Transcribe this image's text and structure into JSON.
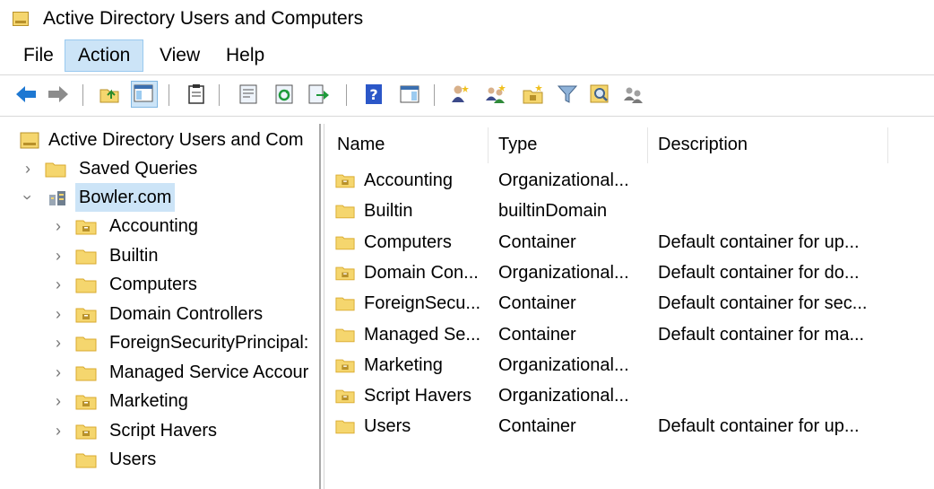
{
  "window": {
    "title": "Active Directory Users and Computers"
  },
  "menu": [
    "File",
    "Action",
    "View",
    "Help"
  ],
  "toolbar": [
    {
      "icon": "back-arrow-icon"
    },
    {
      "icon": "forward-arrow-icon"
    },
    {
      "icon": "up-folder-icon"
    },
    {
      "icon": "show-hide-console-tree-icon"
    },
    {
      "icon": "clipboard-icon"
    },
    {
      "icon": "properties-icon"
    },
    {
      "icon": "refresh-icon"
    },
    {
      "icon": "export-list-icon"
    },
    {
      "icon": "help-icon"
    },
    {
      "icon": "action-pane-icon"
    },
    {
      "icon": "new-user-icon"
    },
    {
      "icon": "new-group-icon"
    },
    {
      "icon": "new-ou-icon"
    },
    {
      "icon": "filter-icon"
    },
    {
      "icon": "find-icon"
    },
    {
      "icon": "add-to-group-icon"
    }
  ],
  "tree": {
    "root": "Active Directory Users and Com",
    "saved_queries": "Saved Queries",
    "domain": "Bowler.com",
    "children": [
      {
        "label": "Accounting",
        "kind": "ou",
        "expandable": true
      },
      {
        "label": "Builtin",
        "kind": "folder",
        "expandable": true
      },
      {
        "label": "Computers",
        "kind": "folder",
        "expandable": true
      },
      {
        "label": "Domain Controllers",
        "kind": "ou",
        "expandable": true
      },
      {
        "label": "ForeignSecurityPrincipal:",
        "kind": "folder",
        "expandable": true
      },
      {
        "label": "Managed Service Accour",
        "kind": "folder",
        "expandable": true
      },
      {
        "label": "Marketing",
        "kind": "ou",
        "expandable": true
      },
      {
        "label": "Script Havers",
        "kind": "ou",
        "expandable": true
      },
      {
        "label": "Users",
        "kind": "folder",
        "expandable": false
      }
    ]
  },
  "list": {
    "columns": [
      "Name",
      "Type",
      "Description"
    ],
    "rows": [
      {
        "name": "Accounting",
        "type": "Organizational...",
        "description": "",
        "kind": "ou"
      },
      {
        "name": "Builtin",
        "type": "builtinDomain",
        "description": "",
        "kind": "folder"
      },
      {
        "name": "Computers",
        "type": "Container",
        "description": "Default container for up...",
        "kind": "folder"
      },
      {
        "name": "Domain Con...",
        "type": "Organizational...",
        "description": "Default container for do...",
        "kind": "ou"
      },
      {
        "name": "ForeignSecu...",
        "type": "Container",
        "description": "Default container for sec...",
        "kind": "folder"
      },
      {
        "name": "Managed Se...",
        "type": "Container",
        "description": "Default container for ma...",
        "kind": "folder"
      },
      {
        "name": "Marketing",
        "type": "Organizational...",
        "description": "",
        "kind": "ou"
      },
      {
        "name": "Script Havers",
        "type": "Organizational...",
        "description": "",
        "kind": "ou"
      },
      {
        "name": "Users",
        "type": "Container",
        "description": "Default container for up...",
        "kind": "folder"
      }
    ]
  },
  "colors": {
    "selection": "#cce4f7",
    "folder": "#f5d66e",
    "folder_dark": "#d9aa2e"
  }
}
